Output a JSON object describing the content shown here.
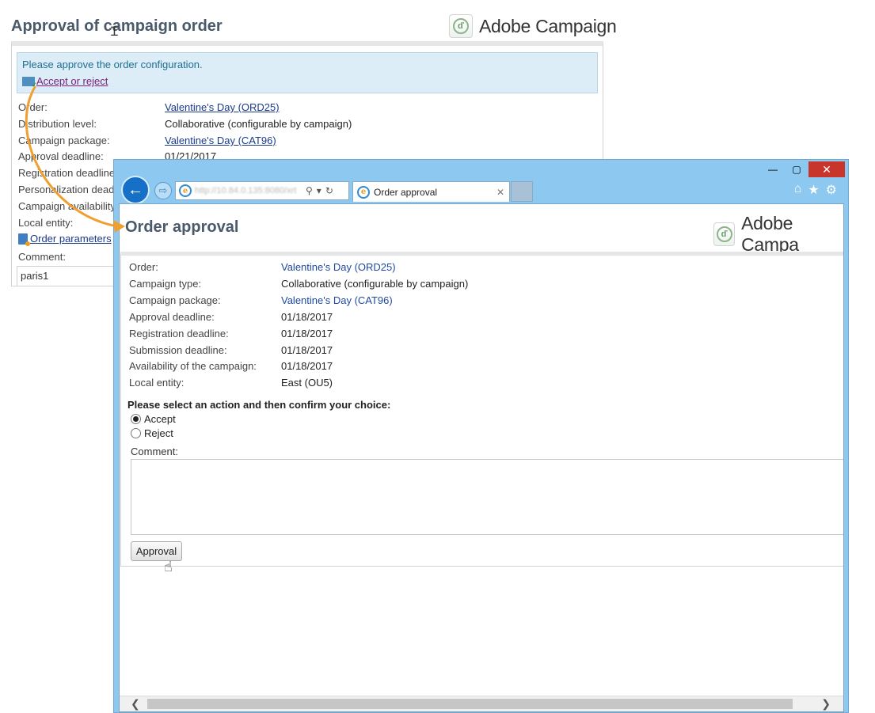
{
  "background_page": {
    "title": "Approval of campaign order",
    "logo_text": "Adobe Campaign",
    "notice_text": "Please approve the order configuration.",
    "accept_link": "Accept or reject",
    "fields": [
      {
        "label": "Order:",
        "value": "Valentine's Day (ORD25)",
        "link": true
      },
      {
        "label": "Distribution level:",
        "value": "Collaborative (configurable by campaign)",
        "link": false
      },
      {
        "label": "Campaign package:",
        "value": "Valentine's Day (CAT96)",
        "link": true
      },
      {
        "label": "Approval deadline:",
        "value": "01/21/2017",
        "link": false
      }
    ],
    "hidden_labels": [
      "Registration deadline",
      "Personalization dead",
      "Campaign availability",
      "Local entity:"
    ],
    "order_parameters": "Order parameters",
    "comment_label": "Comment:",
    "comment_value": "paris1"
  },
  "browser": {
    "tab_title": "Order approval",
    "window_controls": {
      "minimize": "—",
      "maximize": "▢",
      "close": "✕"
    },
    "address_url": "http://10.84.0.135:8080/xrt"
  },
  "approval_page": {
    "title": "Order approval",
    "logo_text": "Adobe Campa",
    "fields": [
      {
        "label": "Order:",
        "value": "Valentine's Day (ORD25)",
        "link": true
      },
      {
        "label": "Campaign type:",
        "value": "Collaborative (configurable by campaign)",
        "link": false
      },
      {
        "label": "Campaign package:",
        "value": "Valentine's Day (CAT96)",
        "link": true
      },
      {
        "label": "Approval deadline:",
        "value": "01/18/2017",
        "link": false
      },
      {
        "label": "Registration deadline:",
        "value": "01/18/2017",
        "link": false
      },
      {
        "label": "Submission deadline:",
        "value": "01/18/2017",
        "link": false
      },
      {
        "label": "Availability of the campaign:",
        "value": "01/18/2017",
        "link": false
      },
      {
        "label": "Local entity:",
        "value": "East (OU5)",
        "link": false
      }
    ],
    "question": "Please select an action and then confirm your choice:",
    "options": [
      {
        "label": "Accept",
        "selected": true
      },
      {
        "label": "Reject",
        "selected": false
      }
    ],
    "comment_label": "Comment:",
    "comment_value": "",
    "approve_button": "Approval"
  },
  "colors": {
    "arrow": "#f0a030",
    "browser_frame": "#8cc8ef",
    "link": "#1f4aa0",
    "notice_bg": "#dcedf7",
    "close_button": "#c7352b"
  }
}
